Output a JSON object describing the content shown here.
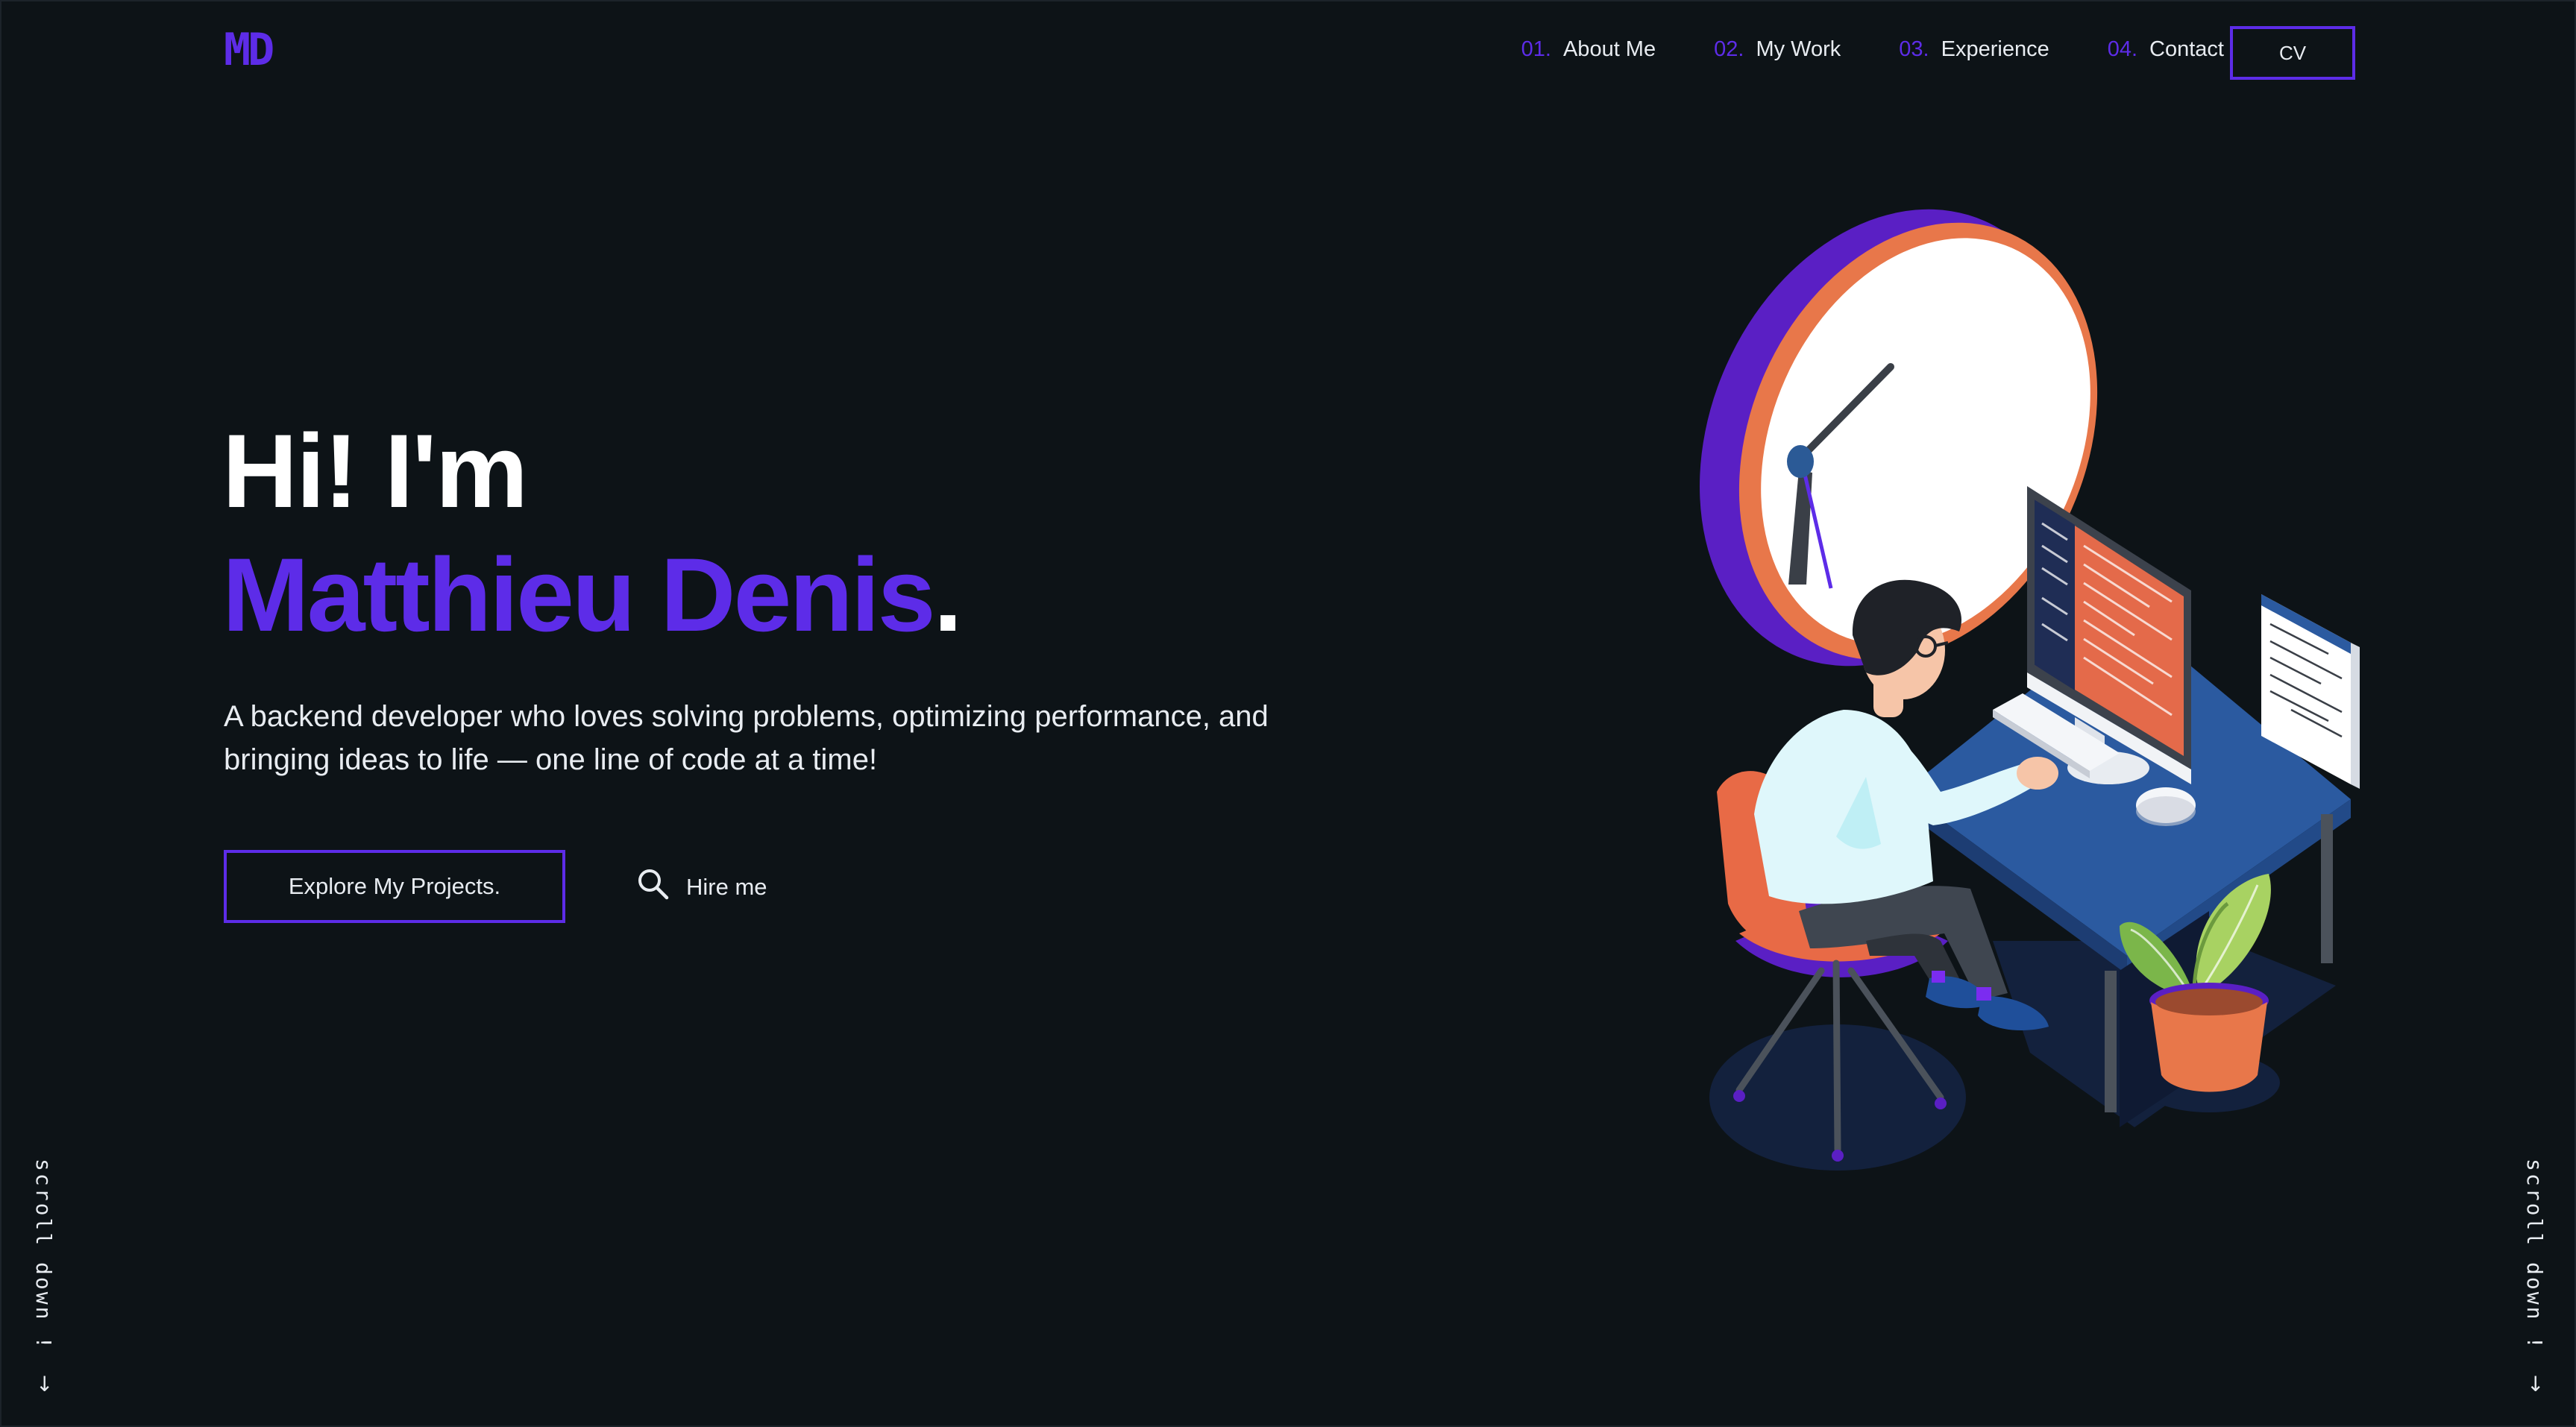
{
  "logo": "MD",
  "nav": [
    {
      "num": "01.",
      "label": "About Me"
    },
    {
      "num": "02.",
      "label": "My Work"
    },
    {
      "num": "03.",
      "label": "Experience"
    },
    {
      "num": "04.",
      "label": "Contact"
    }
  ],
  "cv_label": "CV",
  "hero": {
    "greeting": "Hi! I'm",
    "name": "Matthieu Denis",
    "name_dot": ".",
    "tagline": "A backend developer who loves solving problems, optimizing performance, and bringing ideas to life — one line of code at a time!",
    "primary_cta": "Explore My Projects.",
    "secondary_cta": "Hire me"
  },
  "scroll_text": "scroll down !",
  "scroll_arrow": "↓",
  "colors": {
    "background": "#0d1317",
    "accent": "#5d2ce8",
    "text": "#e8ecf1"
  },
  "icons": {
    "hire": "search-icon",
    "scroll": "arrow-down-icon"
  }
}
